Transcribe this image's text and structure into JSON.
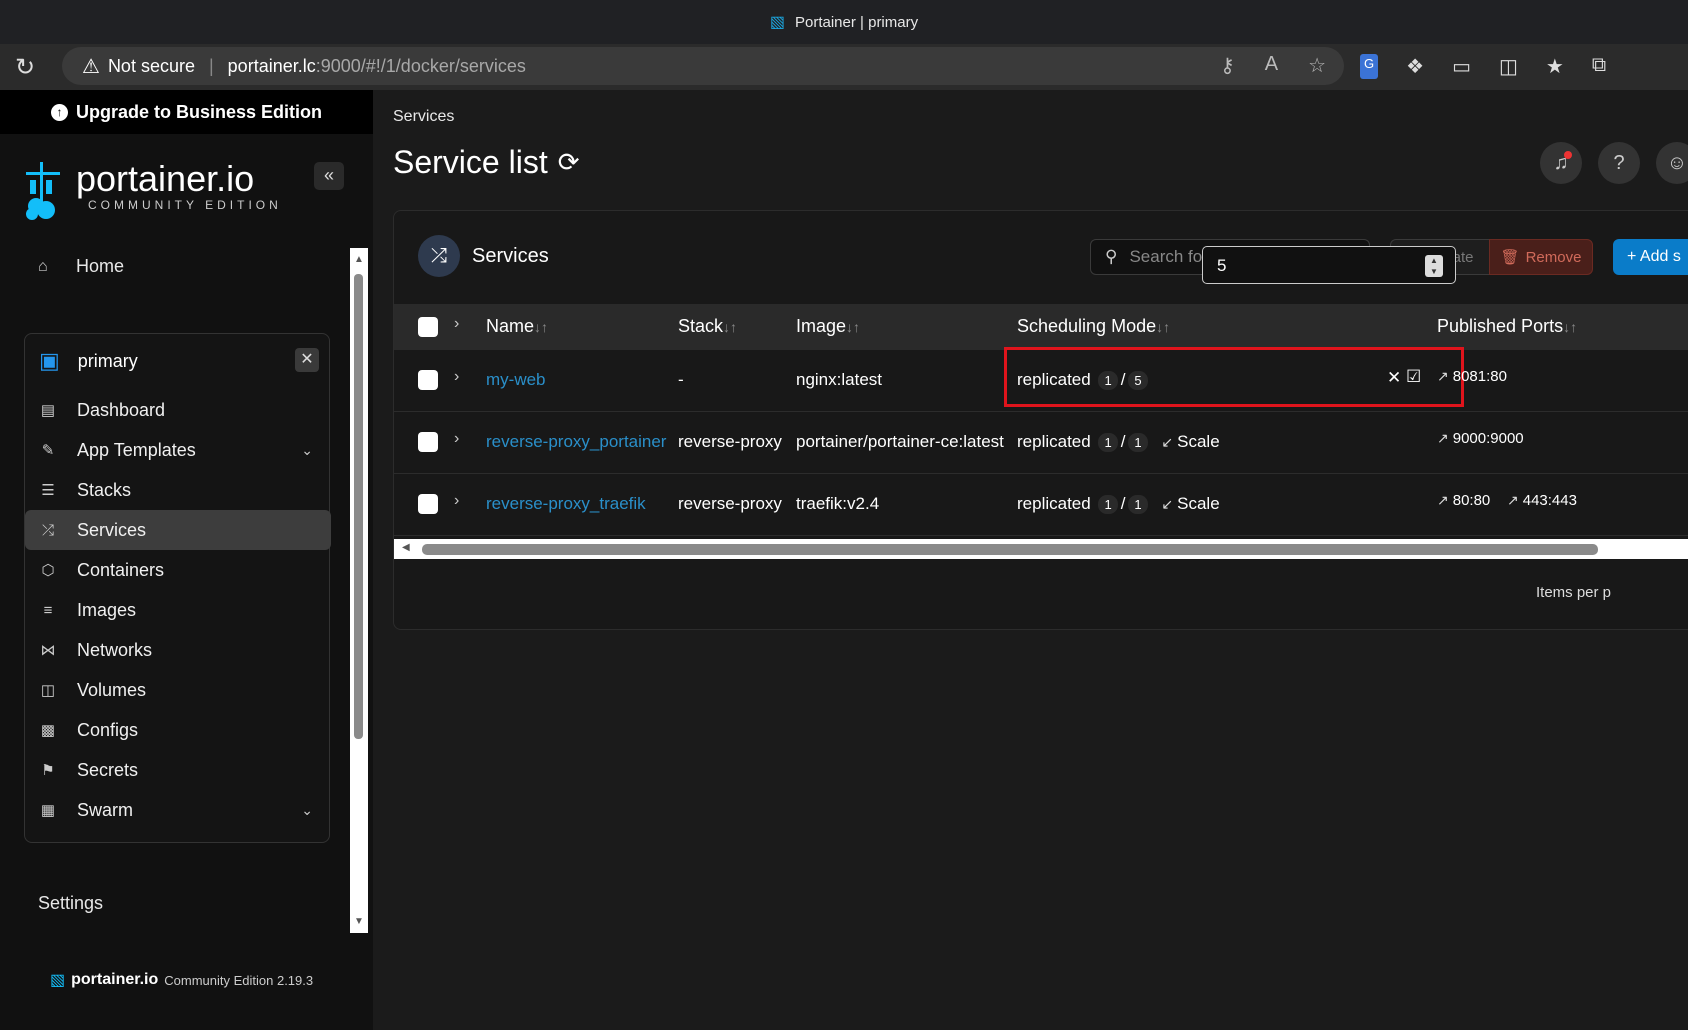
{
  "browser": {
    "tab_title": "Portainer | primary",
    "security_label": "Not secure",
    "url_host": "portainer.lc",
    "url_rest": ":9000/#!/1/docker/services"
  },
  "sidebar": {
    "upgrade_label": "Upgrade to Business Edition",
    "brand_name": "portainer.io",
    "brand_sub": "COMMUNITY EDITION",
    "home_label": "Home",
    "environment_name": "primary",
    "nav_items": [
      {
        "label": "Dashboard",
        "icon": "dashboard-icon"
      },
      {
        "label": "App Templates",
        "icon": "edit-icon"
      },
      {
        "label": "Stacks",
        "icon": "layers-icon"
      },
      {
        "label": "Services",
        "icon": "shuffle-icon"
      },
      {
        "label": "Containers",
        "icon": "box-icon"
      },
      {
        "label": "Images",
        "icon": "list-icon"
      },
      {
        "label": "Networks",
        "icon": "share-icon"
      },
      {
        "label": "Volumes",
        "icon": "database-icon"
      },
      {
        "label": "Configs",
        "icon": "clipboard-icon"
      },
      {
        "label": "Secrets",
        "icon": "lock-icon"
      },
      {
        "label": "Swarm",
        "icon": "grid-icon"
      }
    ],
    "active_item": "Services",
    "settings_label": "Settings",
    "footer_name": "portainer.io",
    "footer_edition": "Community Edition 2.19.3"
  },
  "main": {
    "breadcrumb": "Services",
    "page_title": "Service list",
    "panel_title": "Services",
    "search_placeholder": "Search for a service...",
    "update_label": "Update",
    "remove_label": "Remove",
    "add_label": "+ Add s",
    "columns": [
      "Name",
      "Stack",
      "Image",
      "Scheduling Mode",
      "Published Ports"
    ],
    "rows": [
      {
        "name": "my-web",
        "stack": "-",
        "image": "nginx:latest",
        "mode": "replicated",
        "running": "1",
        "desired": "5",
        "editing": true,
        "edit_value": "5",
        "ports": [
          "8081:80"
        ]
      },
      {
        "name": "reverse-proxy_portainer",
        "stack": "reverse-proxy",
        "image": "portainer/portainer-ce:latest",
        "mode": "replicated",
        "running": "1",
        "desired": "1",
        "scale_label": "Scale",
        "ports": [
          "9000:9000"
        ]
      },
      {
        "name": "reverse-proxy_traefik",
        "stack": "reverse-proxy",
        "image": "traefik:v2.4",
        "mode": "replicated",
        "running": "1",
        "desired": "1",
        "scale_label": "Scale",
        "ports": [
          "80:80",
          "443:443"
        ]
      }
    ],
    "items_per_page": "Items per p"
  },
  "colors": {
    "accent": "#2a8fc9",
    "highlight": "#e0141c",
    "danger": "#d06a5a",
    "primary_button": "#0a7cc9"
  }
}
